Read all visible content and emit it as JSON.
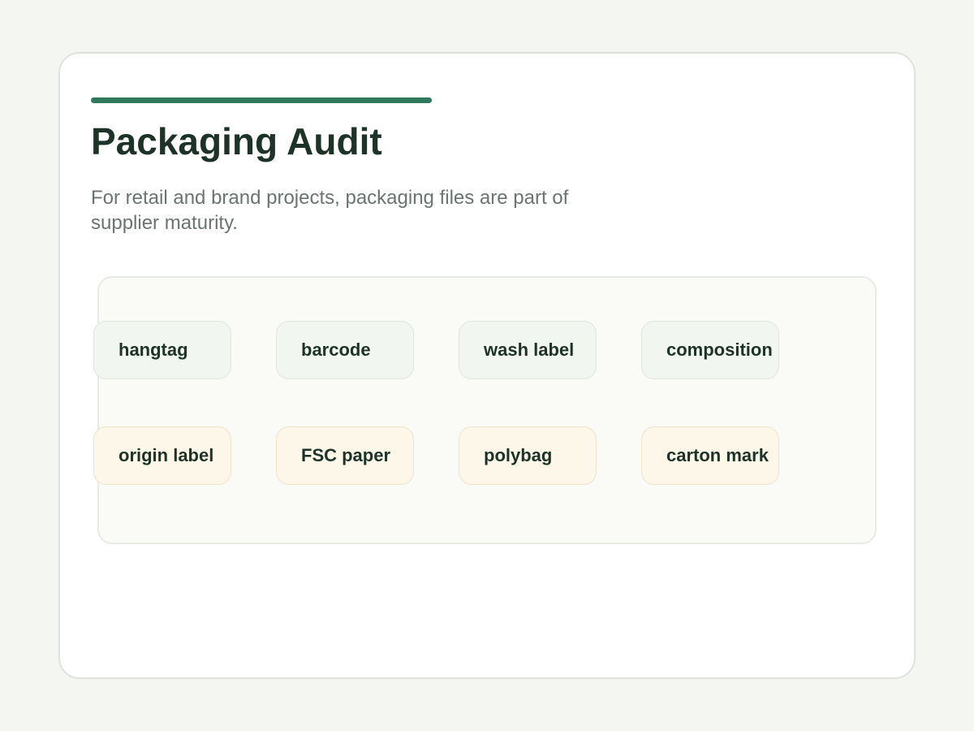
{
  "header": {
    "title": "Packaging Audit",
    "subtitle": "For retail and brand projects, packaging files are part of supplier maturity."
  },
  "chips": {
    "primary": [
      "hangtag",
      "barcode",
      "wash label",
      "composition"
    ],
    "secondary": [
      "origin label",
      "FSC paper",
      "polybag",
      "carton mark"
    ]
  },
  "colors": {
    "accent": "#2f7a5c",
    "title": "#1d3328",
    "primary_chip_bg": "#f2f6f0",
    "secondary_chip_bg": "#fdf7e9"
  }
}
